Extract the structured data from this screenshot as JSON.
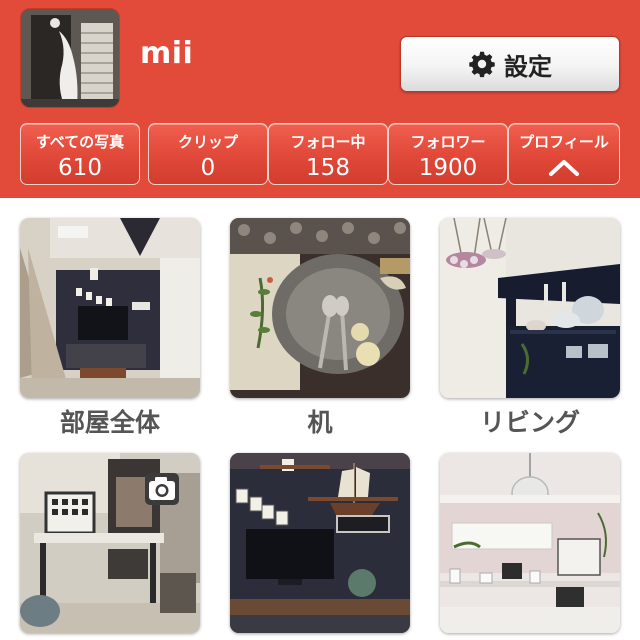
{
  "profile": {
    "username": "mii",
    "settings_label": "設定",
    "settings_icon": "gear-icon"
  },
  "stats": [
    {
      "label": "すべての写真",
      "value": "610"
    },
    {
      "label": "クリップ",
      "value": "0"
    },
    {
      "label": "フォロー中",
      "value": "158"
    },
    {
      "label": "フォロワー",
      "value": "1900"
    },
    {
      "label": "プロフィール",
      "icon": "chevron-up-icon"
    }
  ],
  "albums": [
    {
      "caption": "部屋全体"
    },
    {
      "caption": "机"
    },
    {
      "caption": "リビング"
    },
    {
      "caption": ""
    },
    {
      "caption": ""
    },
    {
      "caption": ""
    }
  ],
  "colors": {
    "header": "#e24a3a",
    "button_bg": "#f4f4f4",
    "caption_text": "#555555"
  }
}
